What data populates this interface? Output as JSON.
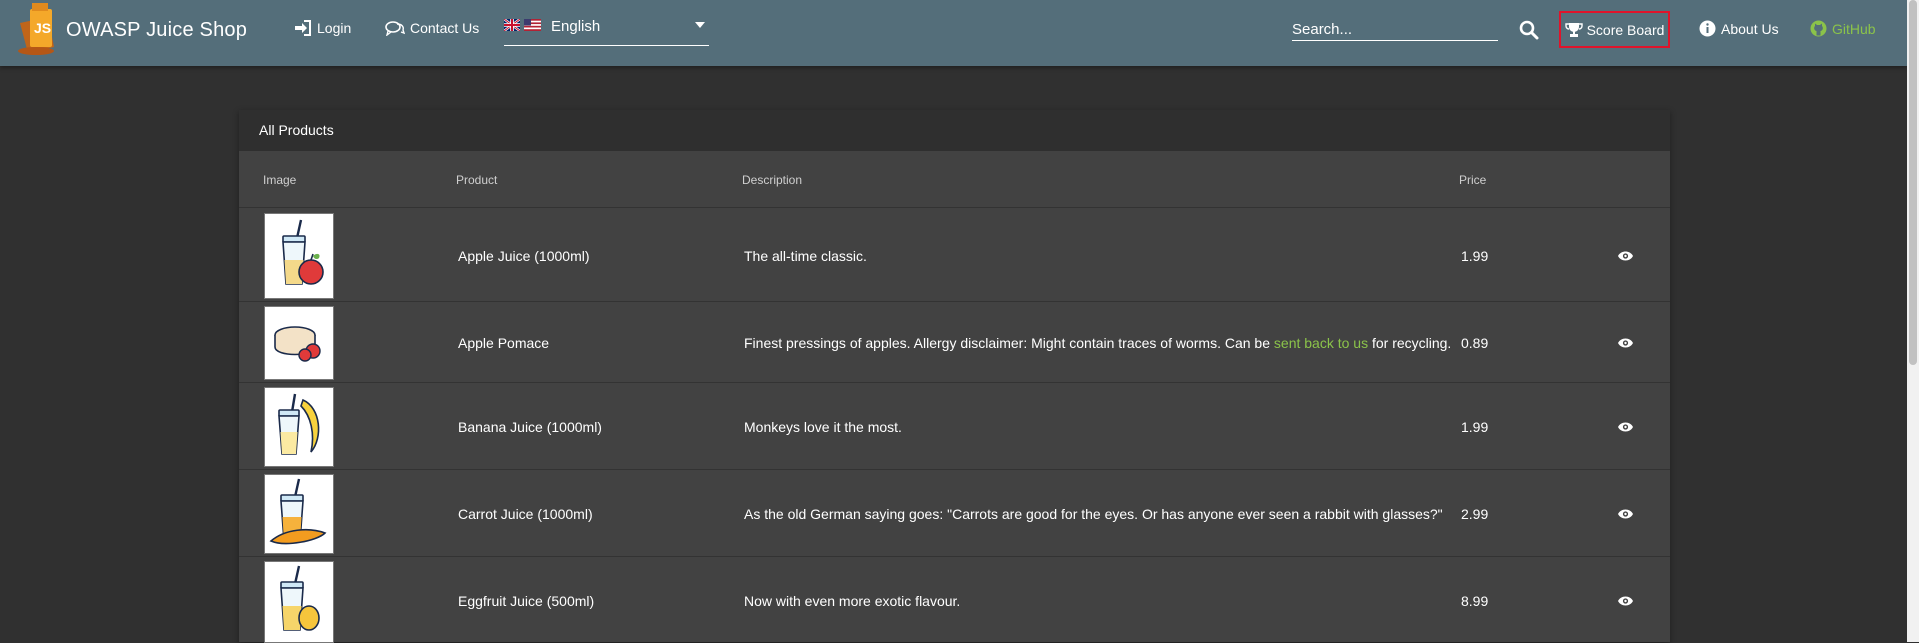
{
  "header": {
    "app_title": "OWASP Juice Shop",
    "login_label": "Login",
    "contact_label": "Contact Us",
    "language_label": "English",
    "search_placeholder": "Search...",
    "score_board_label": "Score Board",
    "about_label": "About Us",
    "github_label": "GitHub",
    "icons": [
      "juice-shop-logo",
      "login-icon",
      "contact-icon",
      "uk-flag",
      "us-flag",
      "search-icon",
      "trophy-icon",
      "info-icon",
      "github-icon"
    ]
  },
  "colors": {
    "toolbar": "#546e7a",
    "background": "#303030",
    "card": "#424242",
    "accent_link": "#8bc34a",
    "highlight_border": "#e0132b"
  },
  "products_table": {
    "title": "All Products",
    "columns": [
      "Image",
      "Product",
      "Description",
      "Price"
    ],
    "rows": [
      {
        "name": "Apple Juice (1000ml)",
        "description": "The all-time classic.",
        "price": "1.99",
        "image": "apple-juice"
      },
      {
        "name": "Apple Pomace",
        "description_before": "Finest pressings of apples. Allergy disclaimer: Might contain traces of worms. Can be ",
        "description_link": "sent back to us",
        "description_after": " for recycling.",
        "price": "0.89",
        "image": "apple-pomace"
      },
      {
        "name": "Banana Juice (1000ml)",
        "description": "Monkeys love it the most.",
        "price": "1.99",
        "image": "banana-juice"
      },
      {
        "name": "Carrot Juice (1000ml)",
        "description": "As the old German saying goes: \"Carrots are good for the eyes. Or has anyone ever seen a rabbit with glasses?\"",
        "price": "2.99",
        "image": "carrot-juice"
      },
      {
        "name": "Eggfruit Juice (500ml)",
        "description": "Now with even more exotic flavour.",
        "price": "8.99",
        "image": "eggfruit-juice"
      }
    ]
  }
}
